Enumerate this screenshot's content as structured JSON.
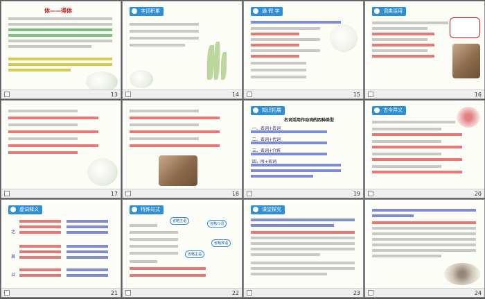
{
  "slides": [
    {
      "num": "13",
      "title": "体——得体",
      "badge": ""
    },
    {
      "num": "14",
      "title": "",
      "badge": "字词积累"
    },
    {
      "num": "15",
      "title": "",
      "badge": "通 假 字"
    },
    {
      "num": "16",
      "title": "",
      "badge": "词类活用"
    },
    {
      "num": "17",
      "title": "",
      "badge": ""
    },
    {
      "num": "18",
      "title": "",
      "badge": ""
    },
    {
      "num": "19",
      "title": "名词活用作动词的四种类型",
      "badge": "知识拓展"
    },
    {
      "num": "20",
      "title": "",
      "badge": "古今异义"
    },
    {
      "num": "21",
      "title": "",
      "badge": "虚词释义"
    },
    {
      "num": "22",
      "title": "",
      "badge": "特殊句式"
    },
    {
      "num": "23",
      "title": "",
      "badge": "课堂探究"
    },
    {
      "num": "24",
      "title": "",
      "badge": ""
    }
  ],
  "slide13": {
    "heading": "体——得体"
  },
  "slide19": {
    "lines": [
      "一、名词+名词",
      "二、名词+代词",
      "三、名词+介宾",
      "四、所+名词"
    ]
  },
  "slide14": {
    "chars": [
      "逡",
      "陀",
      "伐",
      "纠",
      "觇",
      "屠",
      "爰"
    ]
  },
  "slide15": {
    "first": "指出下列句子中的通假字及其意义。"
  },
  "slide16": {
    "first": "指出下列句子中词类活用的词语意义",
    "note": "【提示】"
  },
  "slide20": {
    "first": "指出下列句中的古今异义词并解释其含义。"
  },
  "slide23": {
    "q1": "1. 文中是如何交代秦、晋围郑的原因及形势的？这与整个故事发展有何关系？",
    "tip": "【提示】"
  },
  "slide24": {
    "q2": "2. 文章写烛之武在使命期间，所用“辞”与“说”，说明了什么？",
    "tip": "【提示】"
  },
  "slide22": {
    "labels": [
      "省略句",
      "判断句",
      "被动句",
      "宾语前置"
    ],
    "callouts": [
      "省略主语",
      "省略介词",
      "省略主语",
      "省略宾语"
    ]
  },
  "slide21": {
    "items": [
      "之",
      "其",
      "以",
      "焉"
    ]
  }
}
